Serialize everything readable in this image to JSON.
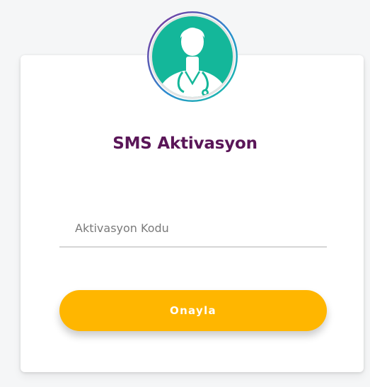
{
  "avatar": {
    "icon": "doctor-stethoscope-icon",
    "bg_color": "#14b79a",
    "ring_gradient": [
      "#8a2b97",
      "#2c8ad0",
      "#15c6a2"
    ]
  },
  "title": "SMS Aktivasyon",
  "input": {
    "placeholder": "Aktivasyon Kodu",
    "value": ""
  },
  "button": {
    "label": "Onayla",
    "color": "#ffb600"
  },
  "colors": {
    "title": "#5a1658",
    "page_bg": "#f5f6f7",
    "card_bg": "#ffffff",
    "input_underline": "#d6d6d6"
  }
}
